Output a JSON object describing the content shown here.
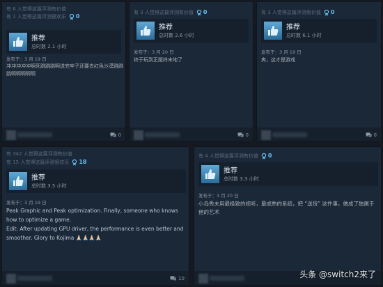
{
  "reviews": [
    {
      "helpful": "有 6 人觉得这篇评测有价值",
      "funny": "有 1 人觉得这篇评测很欢乐",
      "awards": "0",
      "recommendation": "推荐",
      "hours": "总时数 2.1 小时",
      "posted": "发布于：3 月 19 日",
      "body": "冲冲冲冲冲啊死跳跳跳啊送完牢子还要去红色沙漠跳跳跳啊啊啊啊啊",
      "comments": "0"
    },
    {
      "helpful": "有 3 人觉得这篇评测有价值",
      "awards": "0",
      "recommendation": "推荐",
      "hours": "总时数 2.6 小时",
      "posted": "发布于：3 月 20 日",
      "body": "终于玩到正版终末地了",
      "comments": "0"
    },
    {
      "helpful": "有 3 人觉得这篇评测有价值",
      "awards": "0",
      "recommendation": "推荐",
      "hours": "总时数 6.1 小时",
      "posted": "发布于：3 月 19 日",
      "body": "爽，这才是游戏",
      "comments": "0"
    },
    {
      "helpful": "有 342 人觉得这篇评测有价值",
      "funny": "有 15 人觉得这篇评测很欢乐",
      "awards": "18",
      "recommendation": "推荐",
      "hours": "总时数 3.5 小时",
      "posted": "发布于：3 月 19 日",
      "body": "Peak Graphic and Peak optimization. Finally, someone who knows how to optimize a game.",
      "body2": "Edit: After updating GPU driver, the performance is even better and smoother. Glory to Kojima 🙏🏻🙏🏻🙏🏻🙏🏻",
      "comments": "10"
    },
    {
      "helpful": "有 4 人觉得这篇评测有价值",
      "awards": "0",
      "recommendation": "推荐",
      "hours": "总时数 3.3 小时",
      "posted": "发布于：3 月 20 日",
      "body": "小岛秀夫用最极致的视听，最成熟的系统，把 “送货” 这件事，做成了独属于他的艺术",
      "comments": "0"
    }
  ],
  "watermark": "头条 @switch2来了",
  "icons": {
    "award": "award-icon",
    "thumb": "thumbs-up-icon",
    "comment": "comment-icon"
  },
  "colors": {
    "background": "#151a22",
    "card": "#1b2838",
    "accent": "#67c1f5",
    "thumb": "#5fa8d6"
  }
}
